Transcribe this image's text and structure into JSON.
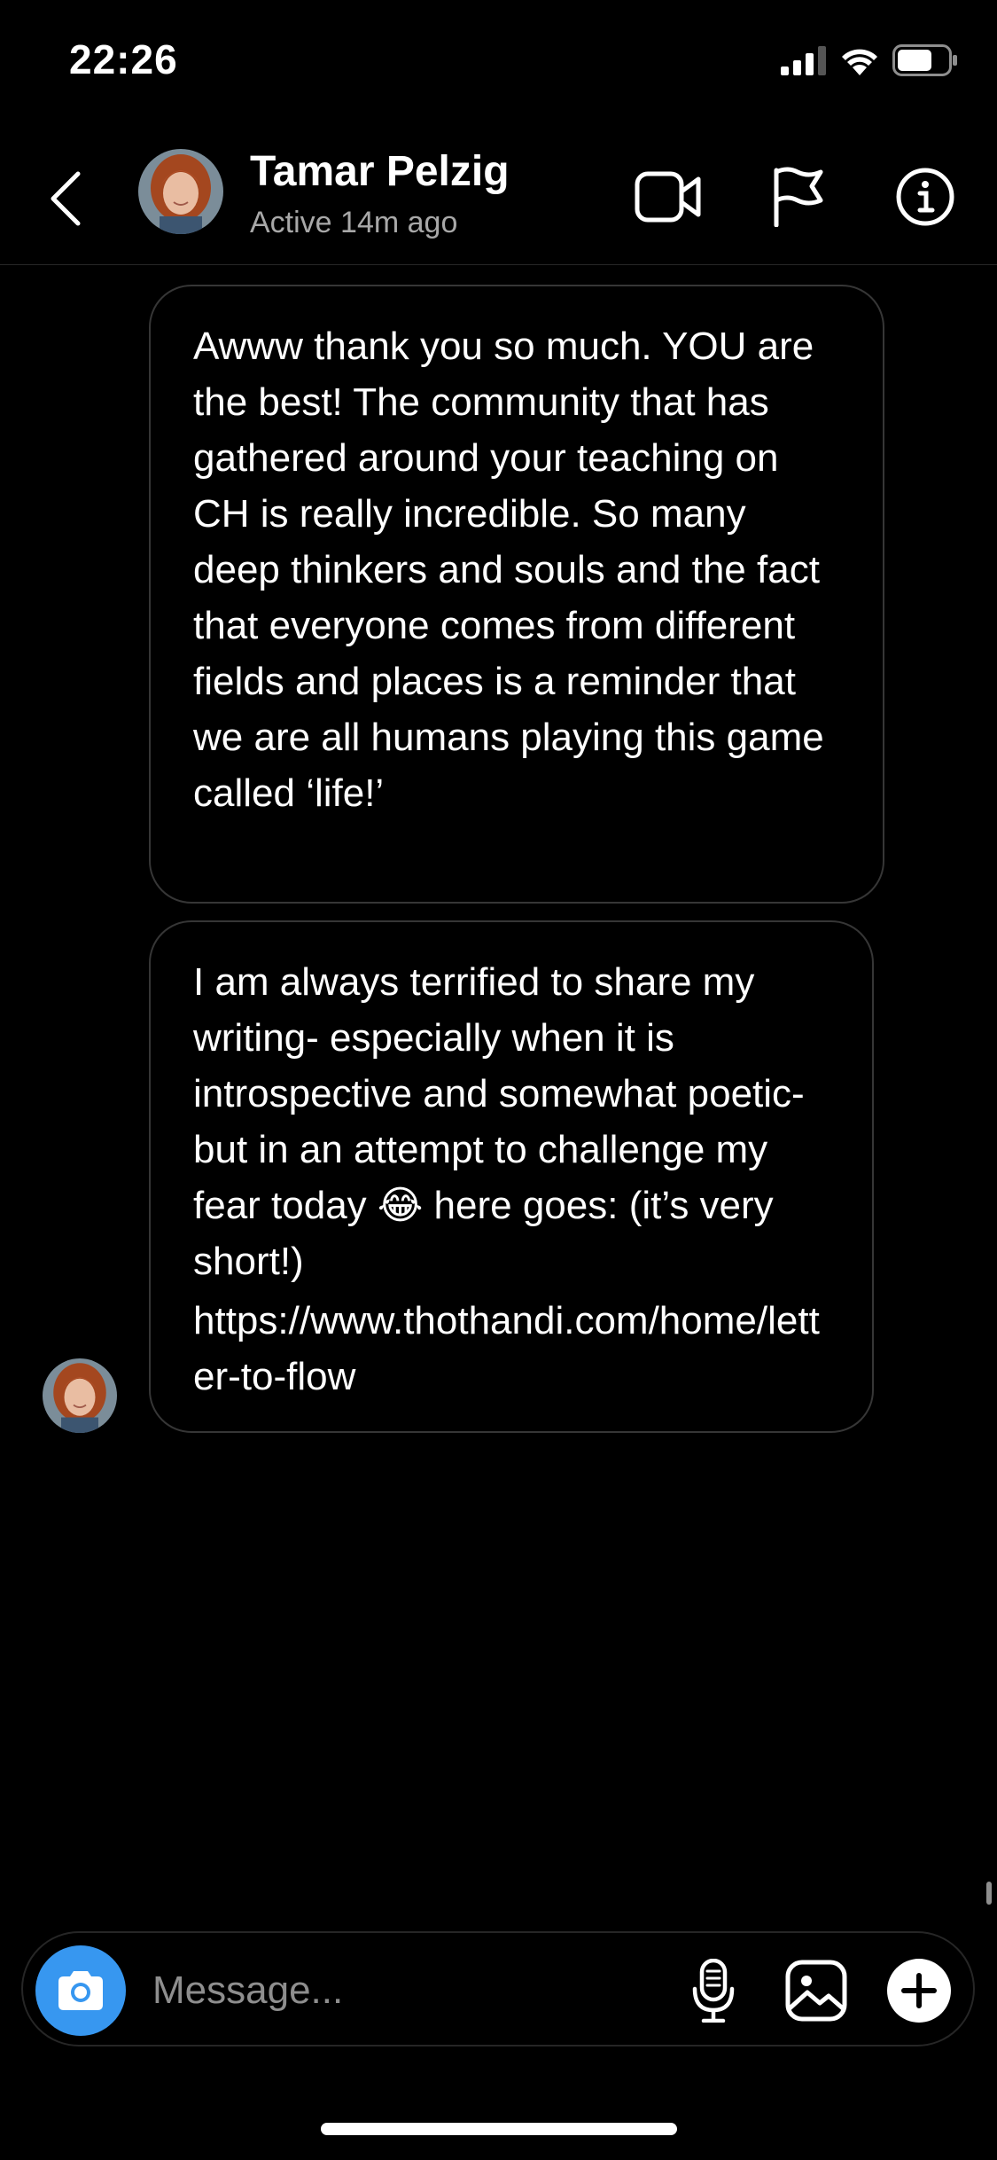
{
  "status_bar": {
    "time": "22:26",
    "icons": [
      "cellular-signal-icon",
      "wifi-icon",
      "battery-icon"
    ]
  },
  "header": {
    "back_icon": "chevron-left-icon",
    "contact_name": "Tamar Pelzig",
    "contact_status": "Active 14m ago",
    "actions": [
      "video-call-icon",
      "flag-icon",
      "info-icon"
    ]
  },
  "messages": [
    {
      "text": "Awww thank you so much. YOU are the best! The community that has gathered around your teaching on CH is really incredible. So many deep thinkers and souls and the fact that everyone comes from different fields and places is a reminder that we are all humans playing this game called ‘life!’"
    },
    {
      "text": "I am always terrified to share my writing- especially when it is introspective and somewhat poetic- but in an attempt to challenge my fear today 😂 here goes: (it’s very short!)",
      "link": "https://www.thothandi.com/home/letter-to-flow"
    }
  ],
  "composer": {
    "placeholder": "Message...",
    "value": "",
    "buttons": [
      "camera-icon",
      "microphone-icon",
      "gallery-icon",
      "plus-icon"
    ]
  },
  "colors": {
    "background": "#000000",
    "bubble_border": "#363636",
    "camera_button": "#3797f0",
    "secondary_text": "#a8a8a8"
  }
}
